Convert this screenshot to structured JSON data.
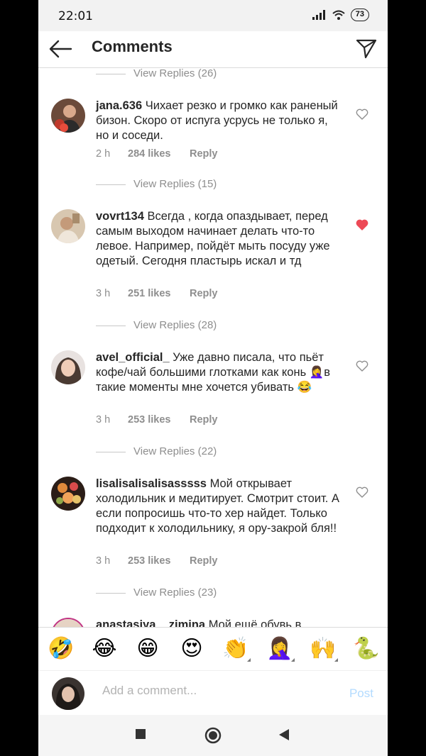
{
  "status": {
    "time": "22:01",
    "battery": "73"
  },
  "header": {
    "title": "Comments"
  },
  "feed": {
    "replies_top": "View Replies (26)",
    "comments": [
      {
        "username": "jana.636",
        "text": "Чихает резко и громко как раненый бизон. Скоро от испуга усрусь не только я, но и соседи.",
        "time": "2 h",
        "likes": "284 likes",
        "reply": "Reply",
        "liked": false,
        "replies": "View Replies (15)"
      },
      {
        "username": "vovrt134",
        "text": "Всегда , когда опаздывает, перед самым выходом начинает делать что-то левое. Например, пойдёт мыть посуду уже одетый. Сегодня пластырь искал и тд",
        "time": "3 h",
        "likes": "251 likes",
        "reply": "Reply",
        "liked": true,
        "replies": "View Replies (28)"
      },
      {
        "username": "avel_official_",
        "text": "Уже давно писала, что пьёт кофе/чай большими глотками как конь 🤦‍♀️в такие моменты мне хочется убивать 😂",
        "time": "3 h",
        "likes": "253 likes",
        "reply": "Reply",
        "liked": false,
        "replies": "View Replies (22)"
      },
      {
        "username": "lisalisalisalisasssss",
        "text": "Мой открывает холодильник и медитирует. Смотрит стоит. А если попросишь что-то хер найдет. Только подходит к холодильнику, я ору-закрой бля!!",
        "time": "3 h",
        "likes": "253 likes",
        "reply": "Reply",
        "liked": false,
        "replies": "View Replies (23)"
      },
      {
        "username": "anastasiya__zimina",
        "text": "Мой ещё обувь в",
        "time": "",
        "likes": "",
        "reply": "",
        "liked": false,
        "replies": ""
      }
    ]
  },
  "emoji_bar": [
    "🤣",
    "😂",
    "😁",
    "😍",
    "👏",
    "🤦‍♀️",
    "🙌",
    "🐍"
  ],
  "composer": {
    "placeholder": "Add a comment...",
    "post_label": "Post"
  },
  "colors": {
    "like_active": "#ed4956",
    "link_disabled": "#b3dbff",
    "meta": "#8e8e8e"
  }
}
